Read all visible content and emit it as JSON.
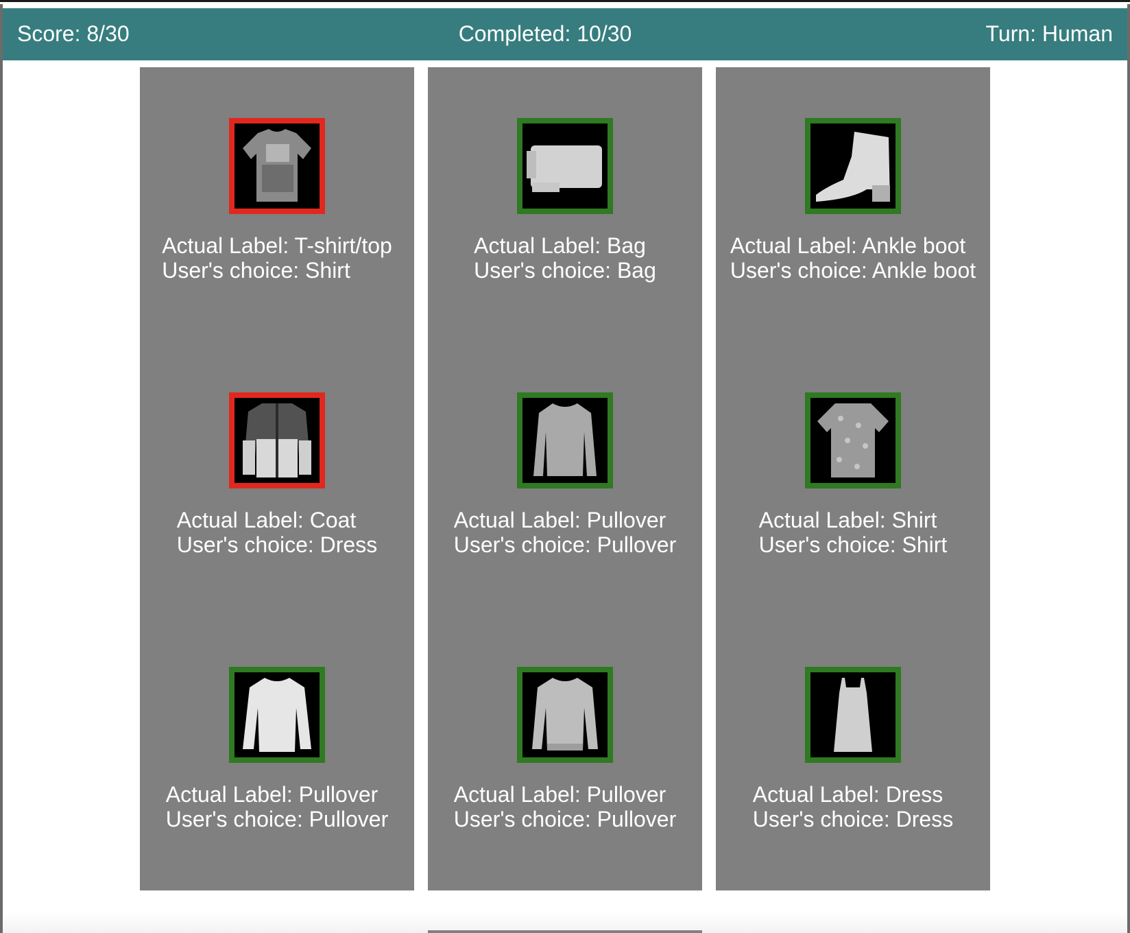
{
  "header": {
    "score": "Score: 8/30",
    "completed": "Completed: 10/30",
    "turn": "Turn: Human"
  },
  "colors": {
    "header_bg": "#377d7f",
    "card_bg": "#808080",
    "correct_border": "#2f7a22",
    "wrong_border": "#e0281e"
  },
  "cards": [
    {
      "actual": "Actual Label: T-shirt/top",
      "choice": "User's choice: Shirt",
      "correct": false,
      "icon": "tshirt-icon"
    },
    {
      "actual": "Actual Label: Bag",
      "choice": "User's choice: Bag",
      "correct": true,
      "icon": "bag-icon"
    },
    {
      "actual": "Actual Label: Ankle boot",
      "choice": "User's choice: Ankle boot",
      "correct": true,
      "icon": "ankle-boot-icon"
    },
    {
      "actual": "Actual Label: Coat",
      "choice": "User's choice: Dress",
      "correct": false,
      "icon": "coat-icon"
    },
    {
      "actual": "Actual Label: Pullover",
      "choice": "User's choice: Pullover",
      "correct": true,
      "icon": "pullover-icon"
    },
    {
      "actual": "Actual Label: Shirt",
      "choice": "User's choice: Shirt",
      "correct": true,
      "icon": "shirt-icon"
    },
    {
      "actual": "Actual Label: Pullover",
      "choice": "User's choice: Pullover",
      "correct": true,
      "icon": "pullover-icon"
    },
    {
      "actual": "Actual Label: Pullover",
      "choice": "User's choice: Pullover",
      "correct": true,
      "icon": "pullover-icon"
    },
    {
      "actual": "Actual Label: Dress",
      "choice": "User's choice: Dress",
      "correct": true,
      "icon": "dress-icon"
    }
  ]
}
